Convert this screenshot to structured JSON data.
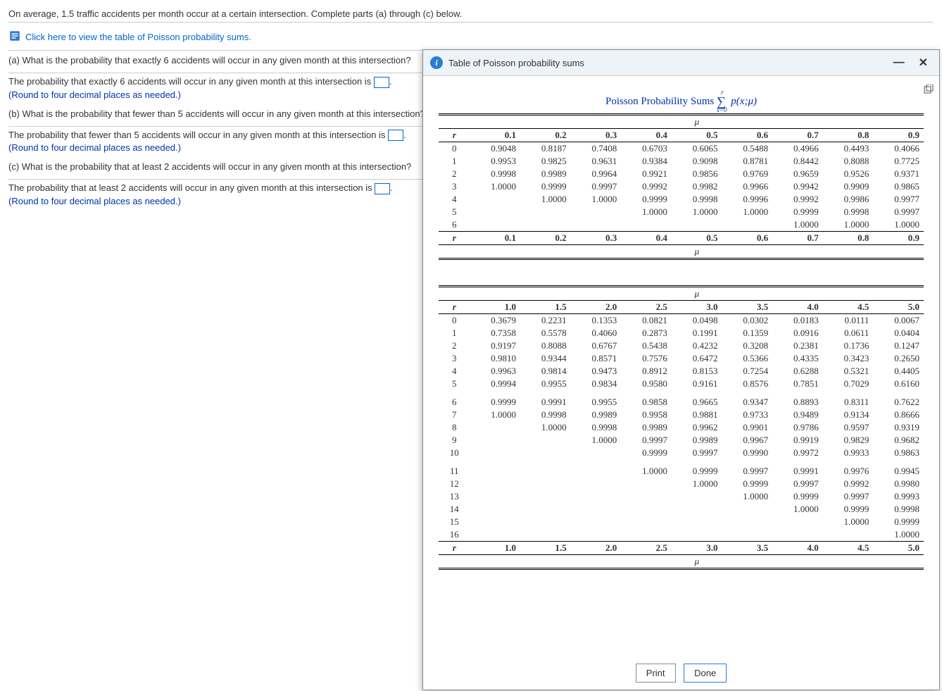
{
  "problem": {
    "intro": "On average, 1.5 traffic accidents per month occur at a certain intersection. Complete parts (a) through (c) below.",
    "table_link": "Click here to view the table of Poisson probability sums."
  },
  "parts": {
    "a": {
      "q": "(a) What is the probability that exactly 6 accidents will occur in any given month at this intersection?",
      "ans_prefix": "The probability that exactly 6 accidents will occur in any given month at this intersection is ",
      "ans_suffix": ".",
      "hint": "(Round to four decimal places as needed.)"
    },
    "b": {
      "q": "(b) What is the probability that fewer than 5 accidents will occur in any given month at this intersection?",
      "ans_prefix": "The probability that fewer than 5 accidents will occur in any given month at this intersection is ",
      "ans_suffix": ".",
      "hint": "(Round to four decimal places as needed.)"
    },
    "c": {
      "q": "(c) What is the probability that at least 2 accidents will occur in any given month at this intersection?",
      "ans_prefix": "The probability that at least 2 accidents will occur in any given month at this intersection is ",
      "ans_suffix": ".",
      "hint": "(Round to four decimal places as needed.)"
    }
  },
  "modal": {
    "title": "Table of Poisson probability sums",
    "table_heading": "Poisson Probability Sums",
    "formula_tex": "∑ p(x;μ) from x=0 to r",
    "mu_label": "μ",
    "r_label": "r",
    "print": "Print",
    "done": "Done"
  },
  "chart_data": [
    {
      "type": "table",
      "title": "Poisson cumulative probabilities, μ = 0.1 to 0.9",
      "columns": [
        "r",
        "0.1",
        "0.2",
        "0.3",
        "0.4",
        "0.5",
        "0.6",
        "0.7",
        "0.8",
        "0.9"
      ],
      "rows": [
        [
          "0",
          "0.9048",
          "0.8187",
          "0.7408",
          "0.6703",
          "0.6065",
          "0.5488",
          "0.4966",
          "0.4493",
          "0.4066"
        ],
        [
          "1",
          "0.9953",
          "0.9825",
          "0.9631",
          "0.9384",
          "0.9098",
          "0.8781",
          "0.8442",
          "0.8088",
          "0.7725"
        ],
        [
          "2",
          "0.9998",
          "0.9989",
          "0.9964",
          "0.9921",
          "0.9856",
          "0.9769",
          "0.9659",
          "0.9526",
          "0.9371"
        ],
        [
          "3",
          "1.0000",
          "0.9999",
          "0.9997",
          "0.9992",
          "0.9982",
          "0.9966",
          "0.9942",
          "0.9909",
          "0.9865"
        ],
        [
          "4",
          "",
          "1.0000",
          "1.0000",
          "0.9999",
          "0.9998",
          "0.9996",
          "0.9992",
          "0.9986",
          "0.9977"
        ],
        [
          "5",
          "",
          "",
          "",
          "1.0000",
          "1.0000",
          "1.0000",
          "0.9999",
          "0.9998",
          "0.9997"
        ],
        [
          "6",
          "",
          "",
          "",
          "",
          "",
          "",
          "1.0000",
          "1.0000",
          "1.0000"
        ]
      ]
    },
    {
      "type": "table",
      "title": "Poisson cumulative probabilities, μ = 1.0 to 5.0",
      "columns": [
        "r",
        "1.0",
        "1.5",
        "2.0",
        "2.5",
        "3.0",
        "3.5",
        "4.0",
        "4.5",
        "5.0"
      ],
      "rows": [
        [
          "0",
          "0.3679",
          "0.2231",
          "0.1353",
          "0.0821",
          "0.0498",
          "0.0302",
          "0.0183",
          "0.0111",
          "0.0067"
        ],
        [
          "1",
          "0.7358",
          "0.5578",
          "0.4060",
          "0.2873",
          "0.1991",
          "0.1359",
          "0.0916",
          "0.0611",
          "0.0404"
        ],
        [
          "2",
          "0.9197",
          "0.8088",
          "0.6767",
          "0.5438",
          "0.4232",
          "0.3208",
          "0.2381",
          "0.1736",
          "0.1247"
        ],
        [
          "3",
          "0.9810",
          "0.9344",
          "0.8571",
          "0.7576",
          "0.6472",
          "0.5366",
          "0.4335",
          "0.3423",
          "0.2650"
        ],
        [
          "4",
          "0.9963",
          "0.9814",
          "0.9473",
          "0.8912",
          "0.8153",
          "0.7254",
          "0.6288",
          "0.5321",
          "0.4405"
        ],
        [
          "5",
          "0.9994",
          "0.9955",
          "0.9834",
          "0.9580",
          "0.9161",
          "0.8576",
          "0.7851",
          "0.7029",
          "0.6160"
        ],
        [
          "6",
          "0.9999",
          "0.9991",
          "0.9955",
          "0.9858",
          "0.9665",
          "0.9347",
          "0.8893",
          "0.8311",
          "0.7622"
        ],
        [
          "7",
          "1.0000",
          "0.9998",
          "0.9989",
          "0.9958",
          "0.9881",
          "0.9733",
          "0.9489",
          "0.9134",
          "0.8666"
        ],
        [
          "8",
          "",
          "1.0000",
          "0.9998",
          "0.9989",
          "0.9962",
          "0.9901",
          "0.9786",
          "0.9597",
          "0.9319"
        ],
        [
          "9",
          "",
          "",
          "1.0000",
          "0.9997",
          "0.9989",
          "0.9967",
          "0.9919",
          "0.9829",
          "0.9682"
        ],
        [
          "10",
          "",
          "",
          "",
          "0.9999",
          "0.9997",
          "0.9990",
          "0.9972",
          "0.9933",
          "0.9863"
        ],
        [
          "11",
          "",
          "",
          "",
          "1.0000",
          "0.9999",
          "0.9997",
          "0.9991",
          "0.9976",
          "0.9945"
        ],
        [
          "12",
          "",
          "",
          "",
          "",
          "1.0000",
          "0.9999",
          "0.9997",
          "0.9992",
          "0.9980"
        ],
        [
          "13",
          "",
          "",
          "",
          "",
          "",
          "1.0000",
          "0.9999",
          "0.9997",
          "0.9993"
        ],
        [
          "14",
          "",
          "",
          "",
          "",
          "",
          "",
          "1.0000",
          "0.9999",
          "0.9998"
        ],
        [
          "15",
          "",
          "",
          "",
          "",
          "",
          "",
          "",
          "1.0000",
          "0.9999"
        ],
        [
          "16",
          "",
          "",
          "",
          "",
          "",
          "",
          "",
          "",
          "1.0000"
        ]
      ]
    }
  ]
}
